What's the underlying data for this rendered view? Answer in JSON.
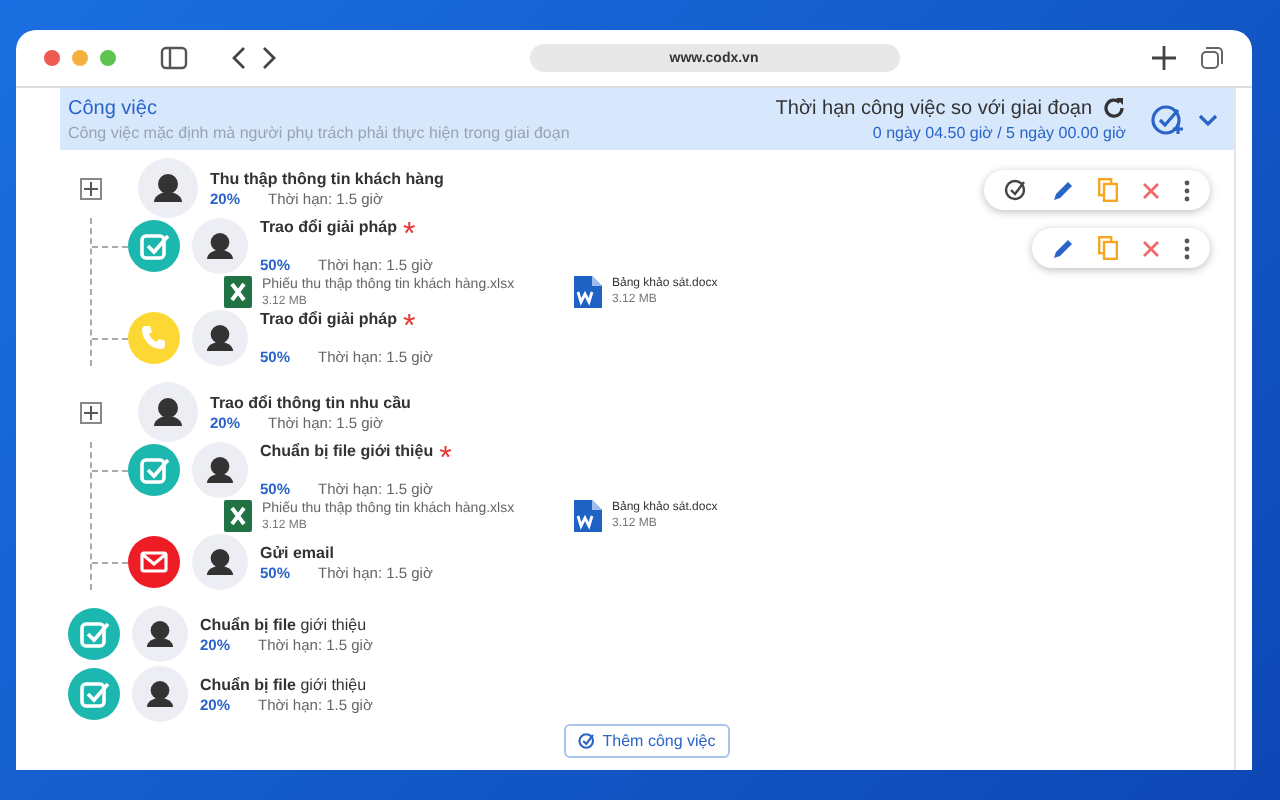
{
  "browser": {
    "url": "www.codx.vn"
  },
  "header": {
    "title": "Công việc",
    "subtitle": "Công việc mặc định mà người phụ trách phải thực hiện trong giai đoạn",
    "deadline_label": "Thời hạn công việc so với giai đoạn",
    "deadline_value": "0 ngày 04.50 giờ / 5 ngày 00.00 giờ"
  },
  "tasks": [
    {
      "kind": "group",
      "name": "Thu thập thông tin khách hàng",
      "progress": "20%",
      "deadline": "Thời hạn: 1.5 giờ",
      "actions": [
        {
          "kind": "assign"
        },
        {
          "kind": "edit"
        },
        {
          "kind": "copy"
        },
        {
          "kind": "delete"
        },
        {
          "kind": "more"
        }
      ],
      "children": [
        {
          "kind": "task",
          "name": "Trao đổi giải pháp",
          "required_mark": "*",
          "progress": "50%",
          "deadline": "Thời hạn: 1.5 giờ",
          "actions": [
            {
              "kind": "edit"
            },
            {
              "kind": "copy"
            },
            {
              "kind": "delete"
            },
            {
              "kind": "more"
            }
          ],
          "files": [
            {
              "kind": "excel",
              "name": "Phiếu thu thập thông tin khách hàng.xlsx",
              "size": "3.12 MB"
            },
            {
              "kind": "word",
              "name": "Bảng khảo sát.docx",
              "size": "3.12 MB"
            }
          ]
        },
        {
          "kind": "call",
          "name": "Trao đổi giải pháp",
          "required_mark": "*",
          "progress": "50%",
          "deadline": "Thời hạn: 1.5 giờ"
        }
      ]
    },
    {
      "kind": "group",
      "name": "Trao đổi thông tin nhu cầu",
      "progress": "20%",
      "deadline": "Thời hạn: 1.5 giờ",
      "children": [
        {
          "kind": "task",
          "name": "Chuẩn bị file giới thiệu",
          "required_mark": "*",
          "progress": "50%",
          "deadline": "Thời hạn: 1.5 giờ",
          "files": [
            {
              "kind": "excel",
              "name": "Phiếu thu thập thông tin khách hàng.xlsx",
              "size": "3.12 MB"
            },
            {
              "kind": "word",
              "name": "Bảng khảo sát.docx",
              "size": "3.12 MB"
            }
          ]
        },
        {
          "kind": "email",
          "name": "Gửi email",
          "progress": "50%",
          "deadline": "Thời hạn: 1.5 giờ"
        }
      ]
    },
    {
      "kind": "task",
      "name": "**Chuẩn bị file** giới thiệu",
      "progress": "20%",
      "deadline": "Thời hạn: 1.5 giờ"
    },
    {
      "kind": "task",
      "name": "**Chuẩn bị file** giới thiệu",
      "progress": "20%",
      "deadline": "Thời hạn: 1.5 giờ"
    }
  ],
  "add_button": "Thêm công việc"
}
